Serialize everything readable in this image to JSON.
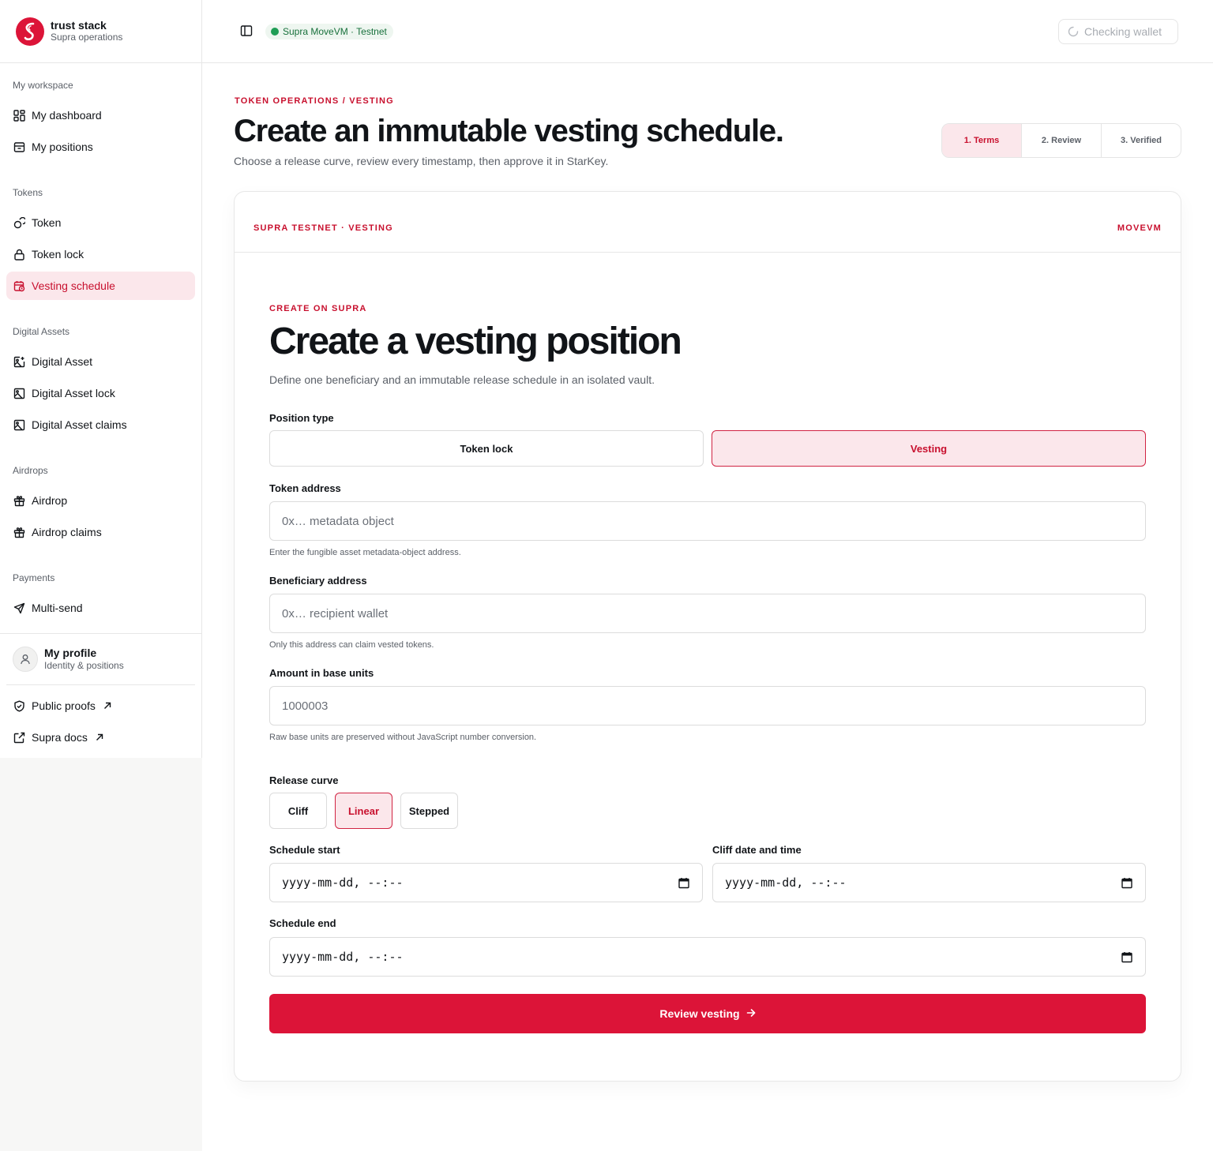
{
  "brand": {
    "name": "trust stack",
    "subtitle": "Supra operations",
    "accent": "#dc1438"
  },
  "sidebar": {
    "sections": [
      {
        "title": "My workspace",
        "items": [
          {
            "label": "My dashboard",
            "icon": "dashboard-icon"
          },
          {
            "label": "My positions",
            "icon": "positions-icon"
          }
        ]
      },
      {
        "title": "Tokens",
        "items": [
          {
            "label": "Token",
            "icon": "coins-icon"
          },
          {
            "label": "Token lock",
            "icon": "lock-icon"
          },
          {
            "label": "Vesting schedule",
            "icon": "calendar-clock-icon",
            "active": true
          }
        ]
      },
      {
        "title": "Digital Assets",
        "items": [
          {
            "label": "Digital Asset",
            "icon": "image-plus-icon"
          },
          {
            "label": "Digital Asset lock",
            "icon": "image-icon"
          },
          {
            "label": "Digital Asset claims",
            "icon": "image-icon"
          }
        ]
      },
      {
        "title": "Airdrops",
        "items": [
          {
            "label": "Airdrop",
            "icon": "gift-icon"
          },
          {
            "label": "Airdrop claims",
            "icon": "gift-icon"
          }
        ]
      },
      {
        "title": "Payments",
        "items": [
          {
            "label": "Multi-send",
            "icon": "send-icon"
          }
        ]
      }
    ],
    "profile": {
      "name": "My profile",
      "subtitle": "Identity & positions"
    },
    "links": [
      {
        "label": "Public proofs",
        "icon": "shield-check-icon"
      },
      {
        "label": "Supra docs",
        "icon": "external-link-icon"
      }
    ]
  },
  "topbar": {
    "network": "Supra MoveVM · Testnet",
    "network_color": "#1f9d55",
    "wallet_status": "Checking wallet"
  },
  "header": {
    "eyebrow": "TOKEN OPERATIONS / VESTING",
    "title": "Create an immutable vesting schedule.",
    "subtitle": "Choose a release curve, review every timestamp, then approve it in StarKey.",
    "steps": [
      "1. Terms",
      "2. Review",
      "3. Verified"
    ],
    "active_step": 1
  },
  "card": {
    "chain_label": "SUPRA TESTNET · VESTING",
    "vm_label": "MOVEVM"
  },
  "form": {
    "eyebrow": "CREATE ON SUPRA",
    "title": "Create a vesting position",
    "subtitle": "Define one beneficiary and an immutable release schedule in an isolated vault.",
    "position_type": {
      "label": "Position type",
      "options": [
        "Token lock",
        "Vesting"
      ],
      "selected": "Vesting"
    },
    "token_address": {
      "label": "Token address",
      "placeholder": "0x… metadata object",
      "value": "",
      "hint": "Enter the fungible asset metadata-object address."
    },
    "beneficiary": {
      "label": "Beneficiary address",
      "placeholder": "0x… recipient wallet",
      "value": "",
      "hint": "Only this address can claim vested tokens."
    },
    "amount": {
      "label": "Amount in base units",
      "placeholder": "1000003",
      "value": "",
      "hint": "Raw base units are preserved without JavaScript number conversion."
    },
    "release_curve": {
      "label": "Release curve",
      "options": [
        "Cliff",
        "Linear",
        "Stepped"
      ],
      "selected": "Linear"
    },
    "schedule_start": {
      "label": "Schedule start",
      "value": "yyyy-mm-dd, --:--"
    },
    "cliff": {
      "label": "Cliff date and time",
      "value": "yyyy-mm-dd, --:--"
    },
    "schedule_end": {
      "label": "Schedule end",
      "value": "yyyy-mm-dd, --:--"
    },
    "submit_label": "Review vesting"
  }
}
